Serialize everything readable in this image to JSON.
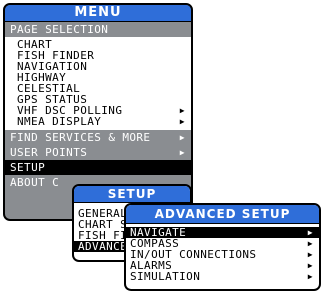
{
  "menu": {
    "title": "MENU",
    "page_selection_header": "PAGE SELECTION",
    "pages": [
      {
        "label": "CHART",
        "arrow": ""
      },
      {
        "label": "FISH FINDER",
        "arrow": ""
      },
      {
        "label": "NAVIGATION",
        "arrow": ""
      },
      {
        "label": "HIGHWAY",
        "arrow": ""
      },
      {
        "label": "CELESTIAL",
        "arrow": ""
      },
      {
        "label": "GPS STATUS",
        "arrow": ""
      },
      {
        "label": "VHF DSC POLLING",
        "arrow": "▶"
      },
      {
        "label": "NMEA DISPLAY",
        "arrow": "▶"
      }
    ],
    "find_services": "FIND SERVICES & MORE",
    "find_services_arrow": "▶",
    "user_points": "USER POINTS",
    "user_points_arrow": "▶",
    "setup": "SETUP",
    "about": "About C"
  },
  "setup_menu": {
    "title": "SETUP",
    "items": [
      "GENERAL",
      "CHART S",
      "FISH FI",
      "ADVANCE"
    ]
  },
  "advanced_setup": {
    "title": "ADVANCED SETUP",
    "items": [
      {
        "label": "NAVIGATE",
        "arrow": "▶",
        "selected": true
      },
      {
        "label": "COMPASS",
        "arrow": "▶"
      },
      {
        "label": "IN/OUT CONNECTIONS",
        "arrow": "▶"
      },
      {
        "label": "ALARMS",
        "arrow": "▶"
      },
      {
        "label": "SIMULATION",
        "arrow": "▶"
      }
    ]
  },
  "colors": {
    "title_bar": "#2f6ed9",
    "section_gray": "#8a8d91",
    "selected_bg": "#000000"
  },
  "icons": {
    "submenu": "submenu-arrow-icon"
  }
}
